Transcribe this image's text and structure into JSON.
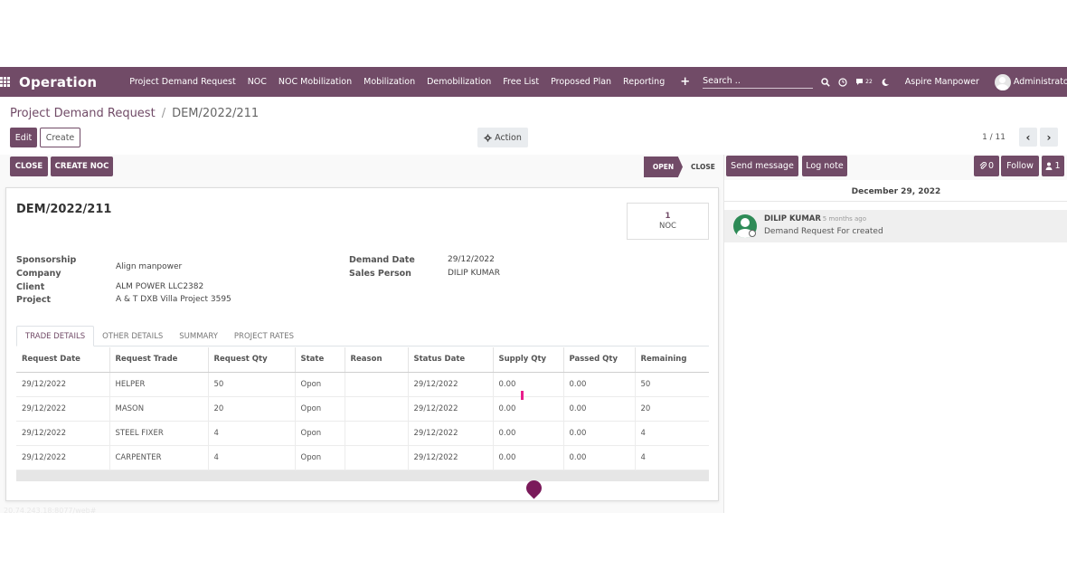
{
  "topbar": {
    "app_name": "Operation",
    "menu": [
      "Project Demand Request",
      "NOC",
      "NOC Mobilization",
      "Mobilization",
      "Demobilization",
      "Free List",
      "Proposed Plan",
      "Reporting"
    ],
    "search_placeholder": "Search ..",
    "messages_count": "22",
    "company": "Aspire Manpower",
    "user": "Administrator"
  },
  "breadcrumb": {
    "parent": "Project Demand Request",
    "separator": "/",
    "current": "DEM/2022/211"
  },
  "buttons": {
    "edit": "Edit",
    "create": "Create",
    "action": "Action",
    "close": "CLOSE",
    "create_noc": "CREATE NOC"
  },
  "pager": {
    "text": "1 / 11"
  },
  "statusbar": {
    "open": "OPEN",
    "close": "CLOSE"
  },
  "record": {
    "title": "DEM/2022/211",
    "smart_button": {
      "count": "1",
      "label": "NOC"
    },
    "fields_left": [
      {
        "label": "Sponsorship",
        "value": ""
      },
      {
        "label": "Company",
        "value": "Align manpower"
      },
      {
        "label": "Client",
        "value": "ALM POWER LLC2382"
      },
      {
        "label": "Project",
        "value": "A & T DXB Villa Project 3595"
      }
    ],
    "fields_right": [
      {
        "label": "Demand Date",
        "value": "29/12/2022"
      },
      {
        "label": "Sales Person",
        "value": "DILIP KUMAR"
      }
    ]
  },
  "tabs": [
    "TRADE DETAILS",
    "OTHER DETAILS",
    "SUMMARY",
    "PROJECT RATES"
  ],
  "table": {
    "columns": [
      "Request Date",
      "Request Trade",
      "Request Qty",
      "State",
      "Reason",
      "Status Date",
      "Supply Qty",
      "Passed Qty",
      "Remaining"
    ],
    "rows": [
      [
        "29/12/2022",
        "HELPER",
        "50",
        "Opon",
        "",
        "29/12/2022",
        "0.00",
        "0.00",
        "50"
      ],
      [
        "29/12/2022",
        "MASON",
        "20",
        "Opon",
        "",
        "29/12/2022",
        "0.00",
        "0.00",
        "20"
      ],
      [
        "29/12/2022",
        "STEEL FIXER",
        "4",
        "Opon",
        "",
        "29/12/2022",
        "0.00",
        "0.00",
        "4"
      ],
      [
        "29/12/2022",
        "CARPENTER",
        "4",
        "Opon",
        "",
        "29/12/2022",
        "0.00",
        "0.00",
        "4"
      ]
    ]
  },
  "chatter": {
    "send_message": "Send message",
    "log_note": "Log note",
    "attachments": "0",
    "follow": "Follow",
    "followers": "1",
    "date": "December 29, 2022",
    "message": {
      "author": "DILIP KUMAR",
      "time": "- 5 months ago",
      "body": "Demand Request For created"
    }
  },
  "footer_text": "20.74.243.18:8077/web#"
}
